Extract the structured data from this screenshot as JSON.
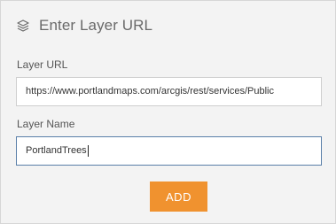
{
  "header": {
    "icon": "layers-icon",
    "title": "Enter Layer URL"
  },
  "fields": {
    "url_label": "Layer URL",
    "url_value": "https://www.portlandmaps.com/arcgis/rest/services/Public",
    "name_label": "Layer Name",
    "name_value": "PortlandTrees"
  },
  "actions": {
    "add_label": "ADD"
  },
  "colors": {
    "accent": "#f0922f",
    "focus_border": "#5a7fa8"
  }
}
